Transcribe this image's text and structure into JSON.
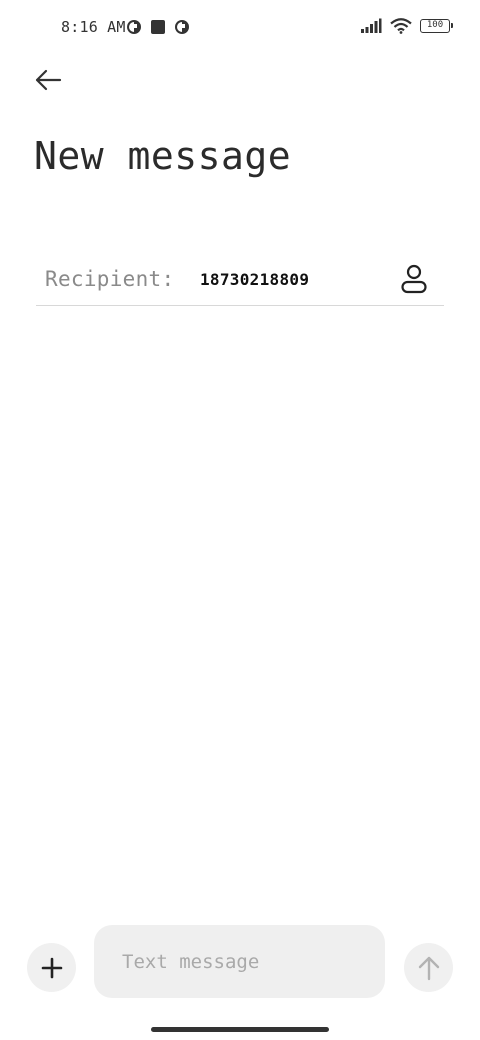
{
  "status_bar": {
    "time": "8:16 AM",
    "battery": "100",
    "icons_left": [
      "app-notification-icon",
      "stop-square-icon",
      "app-notification-icon"
    ],
    "icons_right": [
      "signal-icon",
      "wifi-icon",
      "battery-icon"
    ]
  },
  "header": {
    "back_icon": "arrow-left-icon",
    "title": "New message"
  },
  "recipient": {
    "label": "Recipient:",
    "value": "18730218809",
    "contact_icon": "person-icon"
  },
  "composer": {
    "attach_icon": "plus-icon",
    "placeholder": "Text message",
    "value": "",
    "send_icon": "arrow-up-icon"
  },
  "colors": {
    "background": "#ffffff",
    "input_bg": "#efefef",
    "button_bg": "#f0f0f0",
    "label_gray": "#8a8a8a"
  }
}
